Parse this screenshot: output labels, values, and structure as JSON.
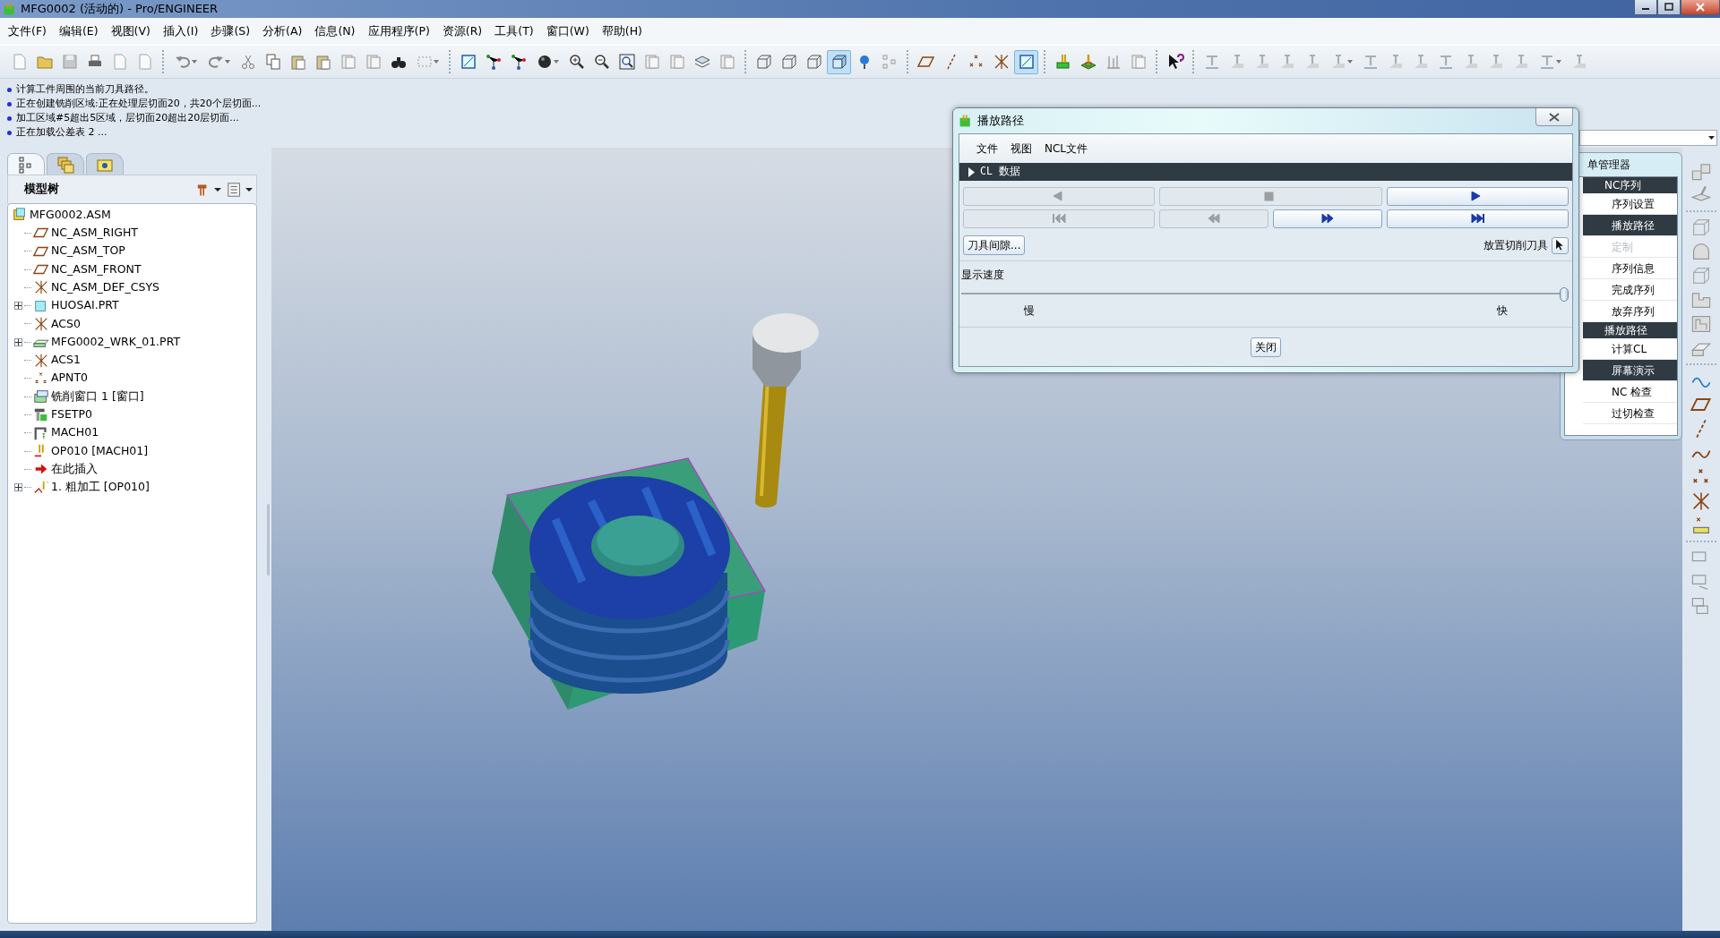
{
  "window": {
    "title": "MFG0002 (活动的) - Pro/ENGINEER"
  },
  "menu": [
    "文件(F)",
    "编辑(E)",
    "视图(V)",
    "插入(I)",
    "步骤(S)",
    "分析(A)",
    "信息(N)",
    "应用程序(P)",
    "资源(R)",
    "工具(T)",
    "窗口(W)",
    "帮助(H)"
  ],
  "messages": [
    "计算工件周围的当前刀具路径。",
    "正在创建铣削区域:正在处理层切面20，共20个层切面...",
    "加工区域#5超出5区域，层切面20超出20层切面...",
    "正在加载公差表 2 ..."
  ],
  "panel_tabs": [
    {
      "kind": "tree",
      "selected": true
    },
    {
      "kind": "layers",
      "selected": false
    },
    {
      "kind": "folder",
      "selected": false
    }
  ],
  "model_tree": {
    "title": "模型树",
    "root": {
      "label": "MFG0002.ASM",
      "kind": "asm",
      "children": [
        {
          "label": "NC_ASM_RIGHT",
          "kind": "plane",
          "collapsed": false
        },
        {
          "label": "NC_ASM_TOP",
          "kind": "plane",
          "collapsed": false
        },
        {
          "label": "NC_ASM_FRONT",
          "kind": "plane",
          "collapsed": false
        },
        {
          "label": "NC_ASM_DEF_CSYS",
          "kind": "csys",
          "collapsed": false
        },
        {
          "label": "HUOSAI.PRT",
          "kind": "part",
          "collapsed": true
        },
        {
          "label": "ACS0",
          "kind": "csys",
          "collapsed": false
        },
        {
          "label": "MFG0002_WRK_01.PRT",
          "kind": "workpiece",
          "collapsed": true
        },
        {
          "label": "ACS1",
          "kind": "csys",
          "collapsed": false
        },
        {
          "label": "APNT0",
          "kind": "point",
          "collapsed": false
        },
        {
          "label": "铣削窗口 1 [窗口]",
          "kind": "window",
          "collapsed": false
        },
        {
          "label": "FSETP0",
          "kind": "fixture",
          "collapsed": false
        },
        {
          "label": "MACH01",
          "kind": "machine",
          "collapsed": false
        },
        {
          "label": "OP010 [MACH01]",
          "kind": "operation",
          "collapsed": false
        },
        {
          "label": "在此插入",
          "kind": "insert",
          "collapsed": false
        },
        {
          "label": "1. 粗加工 [OP010]",
          "kind": "sequence",
          "collapsed": true
        }
      ]
    }
  },
  "dialog": {
    "title": "播放路径",
    "menu": [
      "文件",
      "视图",
      "NCL文件"
    ],
    "section": {
      "label": "CL 数据",
      "expanded": false
    },
    "controls": [
      {
        "kind": "back",
        "disabled": true
      },
      {
        "kind": "stop",
        "disabled": true
      },
      {
        "kind": "play",
        "disabled": false
      },
      {
        "kind": "start",
        "disabled": true
      },
      {
        "kind": "rewind",
        "disabled": true
      },
      {
        "kind": "forward",
        "disabled": false
      },
      {
        "kind": "end",
        "disabled": false
      }
    ],
    "clearance_button": "刀具间隙...",
    "place_tool_label": "放置切削刀具",
    "speed_label": "显示速度",
    "speed": {
      "level": 1.0
    },
    "slow_label": "慢",
    "fast_label": "快",
    "close_button": "关闭"
  },
  "menu_manager": {
    "title": "单管理器",
    "sections": [
      {
        "header": "NC序列",
        "items": [
          {
            "label": "序列设置",
            "selected": false,
            "disabled": false
          },
          {
            "label": "播放路径",
            "selected": true,
            "disabled": false
          },
          {
            "label": "定制",
            "selected": false,
            "disabled": true
          },
          {
            "label": "序列信息",
            "selected": false,
            "disabled": false
          },
          {
            "label": "完成序列",
            "selected": false,
            "disabled": false
          },
          {
            "label": "放弃序列",
            "selected": false,
            "disabled": false
          }
        ]
      },
      {
        "header": "播放路径",
        "items": [
          {
            "label": "计算CL",
            "selected": false,
            "disabled": false
          },
          {
            "label": "屏幕演示",
            "selected": true,
            "disabled": false
          },
          {
            "label": "NC 检查",
            "selected": false,
            "disabled": false
          },
          {
            "label": "过切检查",
            "selected": false,
            "disabled": false
          }
        ]
      }
    ]
  }
}
